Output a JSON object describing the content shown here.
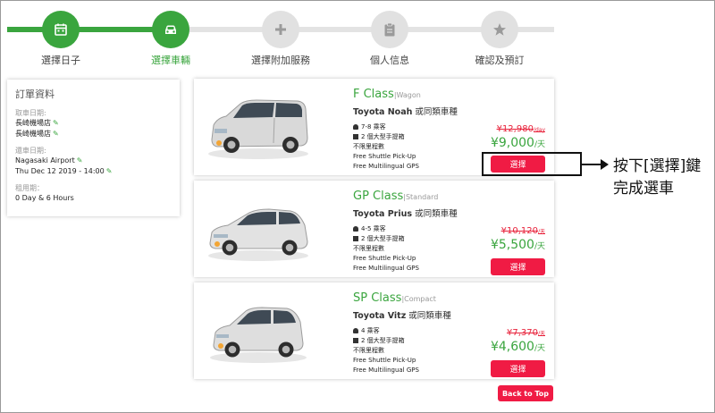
{
  "steps": [
    {
      "label": "選擇日子",
      "icon": "calendar-icon"
    },
    {
      "label": "選擇車輛",
      "icon": "car-icon"
    },
    {
      "label": "選擇附加服務",
      "icon": "plus-icon"
    },
    {
      "label": "個人信息",
      "icon": "clipboard-icon"
    },
    {
      "label": "確認及預訂",
      "icon": "star-icon"
    }
  ],
  "order": {
    "title": "訂單資料",
    "pickup_label": "取車日期:",
    "pickup_line1": "長崎機場店",
    "pickup_line2": "長崎機場店",
    "return_label": "還車日期:",
    "return_location": "Nagasaki Airport",
    "return_datetime": "Thu Dec 12 2019 - 14:00",
    "period_label": "租用期：",
    "period_value": "0 Day & 6 Hours"
  },
  "cars": [
    {
      "class_name": "F Class",
      "class_type": "|Wagon",
      "model": "Toyota Noah",
      "model_alt": " 或同類車種",
      "passengers": "7-8 乘客",
      "luggage": "2 個大型手提箱",
      "mileage": "不限里程數",
      "shuttle": "Free Shuttle Pick-Up",
      "gps": "Free Multilingual GPS",
      "old_price": "¥12,980",
      "old_unit": "/day",
      "price": "¥9,000",
      "price_unit": "/天",
      "select_label": "選擇"
    },
    {
      "class_name": "GP Class",
      "class_type": "|Standard",
      "model": "Toyota Prius",
      "model_alt": " 或同類車種",
      "passengers": "4-5 乘客",
      "luggage": "2 個大型手提箱",
      "mileage": "不限里程數",
      "shuttle": "Free Shuttle Pick-Up",
      "gps": "Free Multilingual GPS",
      "old_price": "¥10,120",
      "old_unit": "/天",
      "price": "¥5,500",
      "price_unit": "/天",
      "select_label": "選擇"
    },
    {
      "class_name": "SP Class",
      "class_type": "|Compact",
      "model": "Toyota Vitz",
      "model_alt": " 或同類車種",
      "passengers": "4 乘客",
      "luggage": "2 個大型手提箱",
      "mileage": "不限里程數",
      "shuttle": "Free Shuttle Pick-Up",
      "gps": "Free Multilingual GPS",
      "old_price": "¥7,370",
      "old_unit": "/天",
      "price": "¥4,600",
      "price_unit": "/天",
      "select_label": "選擇"
    }
  ],
  "annotation": {
    "line1": "按下[選擇]鍵",
    "line2": "完成選車"
  },
  "back_to_top": "Back to Top",
  "colors": {
    "accent": "#3aa53e",
    "button": "#f01b44",
    "inactive_step": "#e1e1e1"
  }
}
